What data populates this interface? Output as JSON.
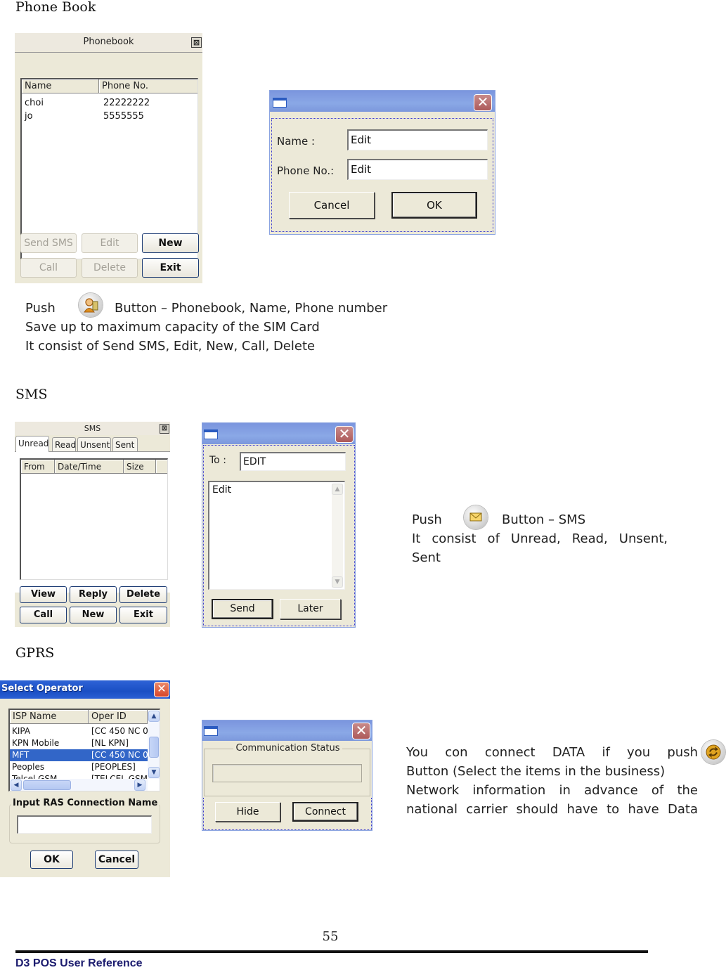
{
  "sections": {
    "phonebook": {
      "heading": "Phone Book",
      "window": {
        "title": "Phonebook",
        "close_glyph": "⊠",
        "columns": [
          "Name",
          "Phone No."
        ],
        "rows": [
          {
            "name": "choi",
            "phone": "22222222"
          },
          {
            "name": "jo",
            "phone": "5555555"
          }
        ],
        "buttons": {
          "send_sms": "Send SMS",
          "edit": "Edit",
          "new": "New",
          "call": "Call",
          "delete": "Delete",
          "exit": "Exit"
        }
      },
      "edit_dialog": {
        "close_glyph": "✕",
        "name_label": "Name :",
        "name_value": "Edit",
        "phone_label": "Phone No.:",
        "phone_value": "Edit",
        "cancel": "Cancel",
        "ok": "OK"
      },
      "description": {
        "push": "Push",
        "icon": "phonebook-icon",
        "line1_rest": "Button – Phonebook, Name, Phone number",
        "line2": "Save up to maximum capacity of the SIM Card",
        "line3": "It consist of Send SMS, Edit, New, Call, Delete"
      }
    },
    "sms": {
      "heading": "SMS",
      "window": {
        "title": "SMS",
        "close_glyph": "⊠",
        "tabs": [
          "Unread",
          "Read",
          "Unsent",
          "Sent"
        ],
        "active_tab": "Unread",
        "columns": [
          "From",
          "Date/Time",
          "Size"
        ],
        "buttons": {
          "view": "View",
          "reply": "Reply",
          "delete": "Delete",
          "call": "Call",
          "new": "New",
          "exit": "Exit"
        }
      },
      "compose_dialog": {
        "close_glyph": "✕",
        "to_label": "To :",
        "to_value": "EDIT",
        "body_value": "Edit",
        "send": "Send",
        "later": "Later"
      },
      "description": {
        "push": "Push",
        "icon": "envelope-icon",
        "line1_rest": "Button – SMS",
        "line2": "It consist of Unread, Read, Unsent,",
        "line3": "Sent"
      }
    },
    "gprs": {
      "heading": "GPRS",
      "operator_window": {
        "title": "Select Operator",
        "close_glyph": "✕",
        "columns": [
          "ISP Name",
          "Oper ID"
        ],
        "rows": [
          {
            "isp": "KIPA",
            "oper": "[CC 450 NC 0"
          },
          {
            "isp": "KPN Mobile",
            "oper": "[NL KPN]"
          },
          {
            "isp": "MFT",
            "oper": "[CC 450 NC 0",
            "selected": true
          },
          {
            "isp": "Peoples",
            "oper": "[PEOPLES]"
          },
          {
            "isp": "Telcel GSM",
            "oper": "[TELCEL GSM"
          }
        ],
        "ras_label": "Input RAS Connection Name",
        "ras_value": "",
        "ok": "OK",
        "cancel": "Cancel"
      },
      "status_dialog": {
        "close_glyph": "✕",
        "group_label": "Communication Status",
        "status_value": "",
        "hide": "Hide",
        "connect": "Connect"
      },
      "description": {
        "line1": "You con connect DATA if you push",
        "icon": "connect-icon",
        "line2": "Button (Select the items in the business)",
        "line3": "Network information in advance of the",
        "line4": "national carrier should have to have Data"
      }
    }
  },
  "footer": {
    "page_number": "55",
    "doc_title": "D3 POS User Reference"
  }
}
